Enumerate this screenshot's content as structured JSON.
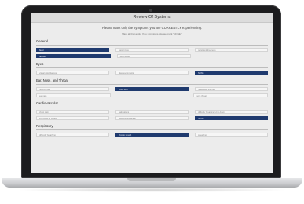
{
  "form": {
    "title": "Review Of Systems",
    "instruction": "Please mark only the symptoms you are CURRENTLY experiencing.",
    "instruction_sub": "Mark all that apply. If no symptoms, please mark \"NONE.\""
  },
  "colors": {
    "selected": "#1f3a6e",
    "option_bg": "#f6f6f6"
  },
  "sections": [
    {
      "label": "General",
      "rows": [
        [
          {
            "label": "fever",
            "selected": true
          },
          {
            "label": "weight loss",
            "selected": false
          },
          {
            "label": "persistent tiredness",
            "selected": false
          }
        ],
        [
          {
            "label": "fatigue",
            "selected": true
          },
          {
            "label": "weight gain",
            "selected": false
          },
          null
        ]
      ]
    },
    {
      "label": "Eyes",
      "rows": [
        [
          {
            "label": "visual disturbances",
            "selected": false
          },
          {
            "label": "glasses/contacts",
            "selected": false
          },
          {
            "label": "NONE",
            "selected": true
          }
        ]
      ]
    },
    {
      "label": "Ear, Nose, and Throat",
      "rows": [
        [
          {
            "label": "hearing loss",
            "selected": false
          },
          {
            "label": "sinus pain",
            "selected": true
          },
          {
            "label": "nosebleed difficulty",
            "selected": false
          }
        ],
        [
          {
            "label": "ear pain",
            "selected": false
          },
          null,
          {
            "label": "sore throat",
            "selected": false
          }
        ]
      ]
    },
    {
      "label": "Cardiovascular",
      "rows": [
        [
          {
            "label": "chest pain",
            "selected": false
          },
          {
            "label": "palpitations",
            "selected": false
          },
          {
            "label": "difficulty breathing lying down",
            "selected": false
          }
        ],
        [
          {
            "label": "shortness of breath",
            "selected": false
          },
          {
            "label": "swelling (leg/ankle)",
            "selected": false
          },
          {
            "label": "NONE",
            "selected": true
          }
        ]
      ]
    },
    {
      "label": "Respiratory",
      "rows": [
        [
          {
            "label": "difficulty breathing",
            "selected": false
          },
          {
            "label": "chronic cough",
            "selected": true
          },
          {
            "label": "wheezing",
            "selected": false
          }
        ]
      ]
    }
  ]
}
